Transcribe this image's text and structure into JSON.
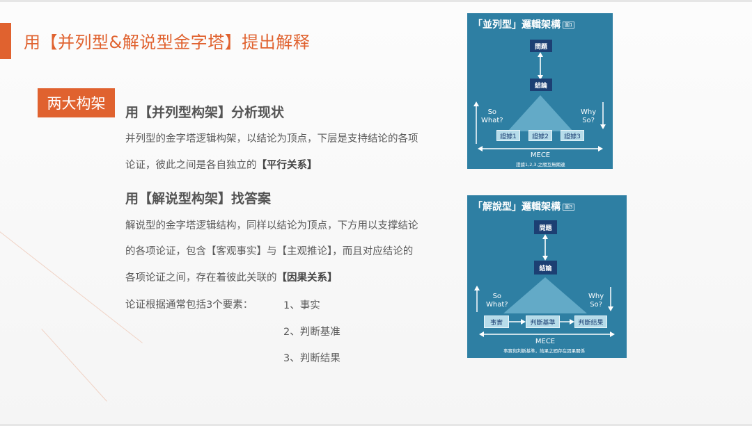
{
  "title": "用【并列型&解说型金字塔】提出解释",
  "tag": "两大构架",
  "section1": {
    "heading": "用【并列型构架】分析现状",
    "line1": "并列型的金字塔逻辑构架，以结论为顶点，下层是支持结论的各项",
    "line2_pre": "论证，彼此之间是各自独立的",
    "line2_bold": "【平行关系】"
  },
  "section2": {
    "heading": "用【解说型构架】找答案",
    "line1": "解说型的金字塔逻辑结构，同样以结论为顶点，下方用以支撑结论",
    "line2": "的各项论证，包含【客观事实】与【主观推论】，而且对应结论的",
    "line3_pre": "各项论证之间，存在着彼此关联的",
    "line3_bold": "【因果关系】",
    "elements_intro": "论证根据通常包括3个要素：",
    "elements": [
      "1、事实",
      "2、判断基准",
      "3、判断结果"
    ]
  },
  "diagram1": {
    "title": "「並列型」邏輯架構",
    "note": "圖1",
    "top_box": "問題",
    "conclusion": "結論",
    "left_text": "So\nWhat?",
    "right_text": "Why\nSo?",
    "boxes": [
      "證據1",
      "證據2",
      "證據3"
    ],
    "mece": "MECE",
    "footnote": "證據1,2,3,之間互無關連"
  },
  "diagram2": {
    "title": "「解說型」邏輯架構",
    "note": "圖3",
    "top_box": "問題",
    "conclusion": "結論",
    "left_text": "So\nWhat?",
    "right_text": "Why\nSo?",
    "boxes": [
      "事實",
      "判斷基準",
      "判斷結果"
    ],
    "mece": "MECE",
    "footnote": "事實與判斷基準，結果之間存在因果關係"
  },
  "colors": {
    "accent": "#e0622f",
    "diagram_bg": "#2e7fa3",
    "diagram_navy": "#1c3f73",
    "diagram_light": "#b6dcea"
  }
}
